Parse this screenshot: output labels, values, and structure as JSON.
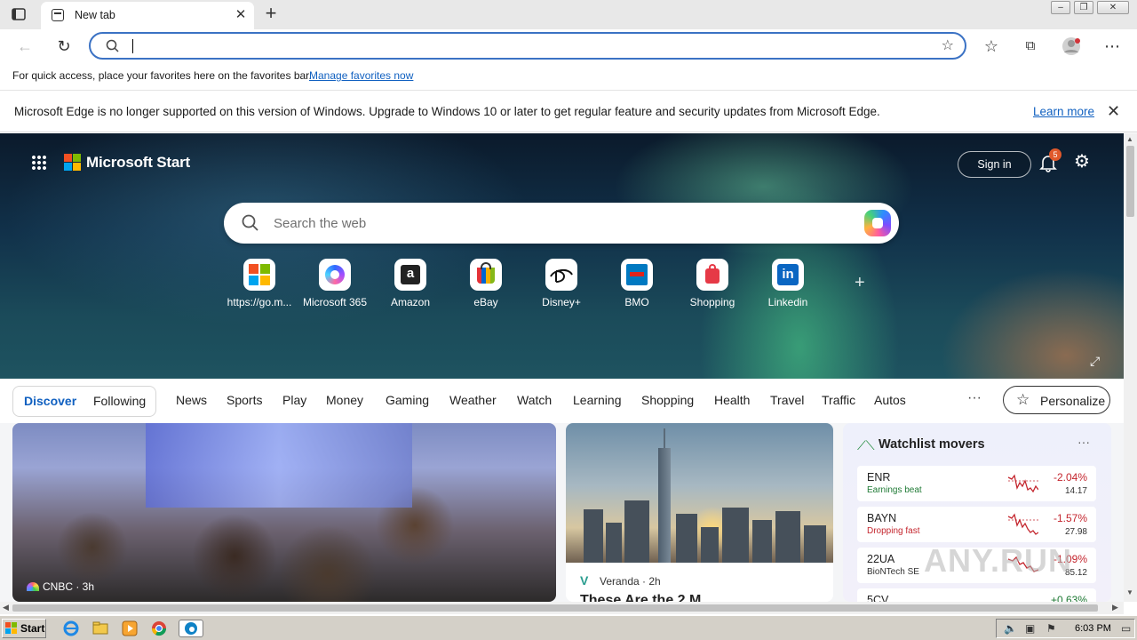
{
  "browser": {
    "tab_title": "New tab",
    "address_value": "",
    "favorites_bar": {
      "message": "For quick access, place your favorites here on the favorites bar.",
      "link": "Manage favorites now"
    },
    "infobar": {
      "message": "Microsoft Edge is no longer supported on this version of Windows. Upgrade to Windows 10 or later to get regular feature and security updates from Microsoft Edge.",
      "link": "Learn more"
    }
  },
  "start": {
    "brand": "Microsoft Start",
    "signin": "Sign in",
    "notification_count": "5",
    "search_placeholder": "Search the web",
    "quick_links": [
      {
        "label": "https://go.m...",
        "icon": "microsoft-icon"
      },
      {
        "label": "Microsoft 365",
        "icon": "m365-icon"
      },
      {
        "label": "Amazon",
        "icon": "amazon-icon"
      },
      {
        "label": "eBay",
        "icon": "ebay-icon"
      },
      {
        "label": "Disney+",
        "icon": "disney-icon"
      },
      {
        "label": "BMO",
        "icon": "bmo-icon"
      },
      {
        "label": "Shopping",
        "icon": "shopping-icon"
      },
      {
        "label": "Linkedin",
        "icon": "linkedin-icon"
      }
    ],
    "feed_switch": [
      "Discover",
      "Following"
    ],
    "nav": [
      "News",
      "Sports",
      "Play",
      "Money",
      "Gaming",
      "Weather",
      "Watch",
      "Learning",
      "Shopping",
      "Health",
      "Travel",
      "Traffic",
      "Autos"
    ],
    "personalize": "Personalize",
    "cards": {
      "card1_source": "CNBC · 3h",
      "card2_source": "Veranda · 2h",
      "card2_headline": "These Are the 2 M..."
    },
    "watchlist": {
      "title": "Watchlist movers",
      "stocks": [
        {
          "symbol": "ENR",
          "tag": "Earnings beat",
          "tag_color": "#1f7a35",
          "change": "-2.04%",
          "price": "14.17"
        },
        {
          "symbol": "BAYN",
          "tag": "Dropping fast",
          "tag_color": "#c4262e",
          "change": "-1.57%",
          "price": "27.98"
        },
        {
          "symbol": "22UA",
          "tag": "BioNTech SE",
          "tag_color": "#333333",
          "change": "-1.09%",
          "price": "85.12"
        },
        {
          "symbol": "5CV",
          "tag": "",
          "tag_color": "#333333",
          "change": "+0.63%",
          "price": ""
        }
      ]
    }
  },
  "watermark": "ANY.RUN",
  "taskbar": {
    "start": "Start",
    "clock": "6:03 PM"
  }
}
